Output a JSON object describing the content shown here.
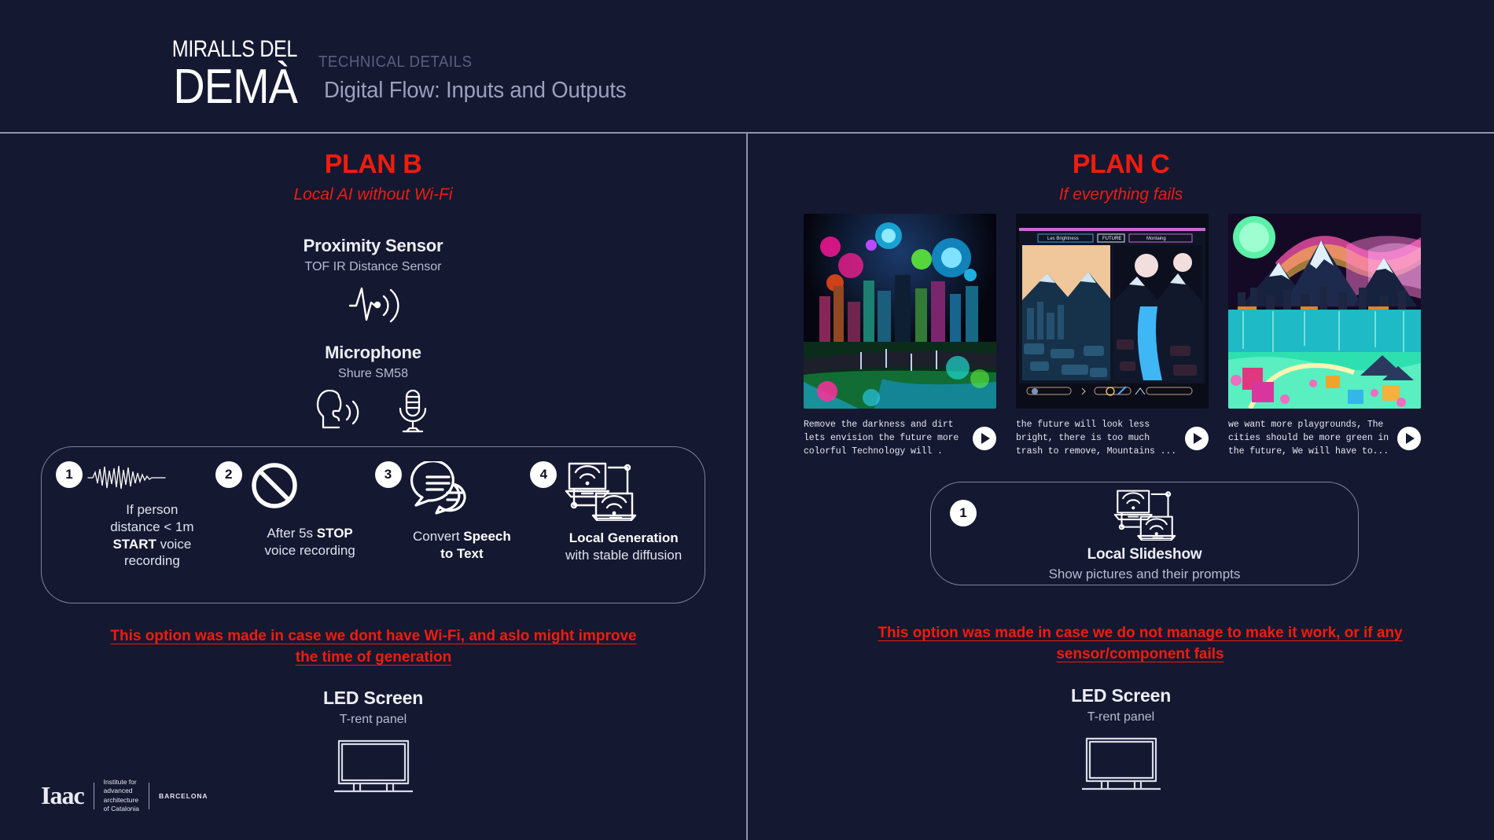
{
  "brand": {
    "line1": "MIRALLS DEL",
    "line2": "DEMÀ"
  },
  "header": {
    "kicker": "TECHNICAL DETAILS",
    "title": "Digital Flow: Inputs and Outputs"
  },
  "colors": {
    "background": "#151831",
    "accent_red": "#f01c0c",
    "rule": "#8e93ae",
    "text_primary": "#eceef5",
    "text_secondary": "#b8bccd"
  },
  "plan_b": {
    "title": "PLAN B",
    "subtitle": "Local AI without Wi-Fi",
    "devices": [
      {
        "name": "Proximity Sensor",
        "model": "TOF IR Distance Sensor",
        "icon": "proximity-sensor-icon"
      },
      {
        "name": "Microphone",
        "model": "Shure SM58",
        "icon": "microphone-icon"
      }
    ],
    "steps": [
      {
        "number": "1",
        "icon": "waveform-icon",
        "caption_html": "If person<br>distance &lt; 1m<br><b>START</b> voice<br>recording"
      },
      {
        "number": "2",
        "icon": "prohibited-icon",
        "caption_html": "After 5s <b>STOP</b><br>voice recording"
      },
      {
        "number": "3",
        "icon": "speech-bubbles-icon",
        "caption_html": "Convert <b>Speech<br>to Text</b>"
      },
      {
        "number": "4",
        "icon": "laptops-wifi-icon",
        "caption_html": "<b>Local Generation</b><br>with stable diffusion"
      }
    ],
    "warning": "This option was made in case we dont have Wi-Fi, and aslo might improve the time of generation",
    "output": {
      "name": "LED Screen",
      "model": "T-rent panel",
      "icon": "led-screen-icon"
    }
  },
  "plan_c": {
    "title": "PLAN C",
    "subtitle": "If everything fails",
    "thumbnails": [
      {
        "alt": "neon pixel-art future city with glowing orbs and green park",
        "prompt": "Remove the darkness and dirt lets envision the future more colorful  Technology will ."
      },
      {
        "alt": "split-screen pixel art of polluted city and mountain river",
        "prompt": "the future will look less bright, there is too much trash to remove, Mountains ..."
      },
      {
        "alt": "neon mountains with teal lake and colorful playground",
        "prompt": "we want more playgrounds, The cities should be more green in the future, We will have to..."
      }
    ],
    "steps": [
      {
        "number": "1",
        "icon": "laptops-wifi-icon",
        "title": "Local Slideshow",
        "subtitle": "Show pictures and their prompts"
      }
    ],
    "warning": "This option was made in case we do not manage to make it work, or if any sensor/component fails",
    "output": {
      "name": "LED Screen",
      "model": "T-rent panel",
      "icon": "led-screen-icon"
    }
  },
  "footer_logo": {
    "wordmark": "Iaac",
    "descriptor": "Institute for\nadvanced\narchitecture\nof Catalonia",
    "city": "BARCELONA"
  }
}
